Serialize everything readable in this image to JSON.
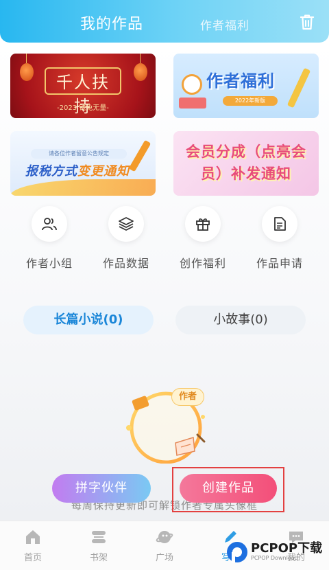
{
  "header": {
    "tab_active": "我的作品",
    "tab_inactive": "作者福利",
    "trash_icon": "trash-icon"
  },
  "banners": [
    {
      "title": "千人扶持",
      "subtitle": "-2023 钱兔无量-"
    },
    {
      "title": "作者福利",
      "tag": "2022年新版"
    },
    {
      "top_text": "请各位作者留意公告规定",
      "title_main": "报税方式",
      "title_accent": "变更通知"
    },
    {
      "line1": "会员分成（点亮会",
      "line2": "员）补发通知"
    }
  ],
  "quick_actions": [
    {
      "label": "作者小组",
      "icon": "users-icon"
    },
    {
      "label": "作品数据",
      "icon": "layers-icon"
    },
    {
      "label": "创作福利",
      "icon": "gift-icon"
    },
    {
      "label": "作品申请",
      "icon": "document-icon"
    }
  ],
  "segments": {
    "long": "长篇小说(0)",
    "short": "小故事(0)"
  },
  "illustration": {
    "badge": "作者"
  },
  "buttons": {
    "partner": "拼字伙伴",
    "create": "创建作品"
  },
  "hint": "每周保持更新即可解锁作者专属头像框",
  "nav": [
    {
      "label": "首页",
      "icon": "home-icon"
    },
    {
      "label": "书架",
      "icon": "bookshelf-icon"
    },
    {
      "label": "广场",
      "icon": "planet-icon"
    },
    {
      "label": "写作",
      "icon": "pen-icon",
      "active": true
    },
    {
      "label": "我的",
      "icon": "chat-icon"
    }
  ],
  "watermark": {
    "text": "PCPOP下载",
    "sub": "PCPOP Download"
  },
  "colors": {
    "header": "#28b7f0",
    "accent_blue": "#1a86d8",
    "create_button": "#f34f79",
    "highlight_border": "#e34040"
  }
}
